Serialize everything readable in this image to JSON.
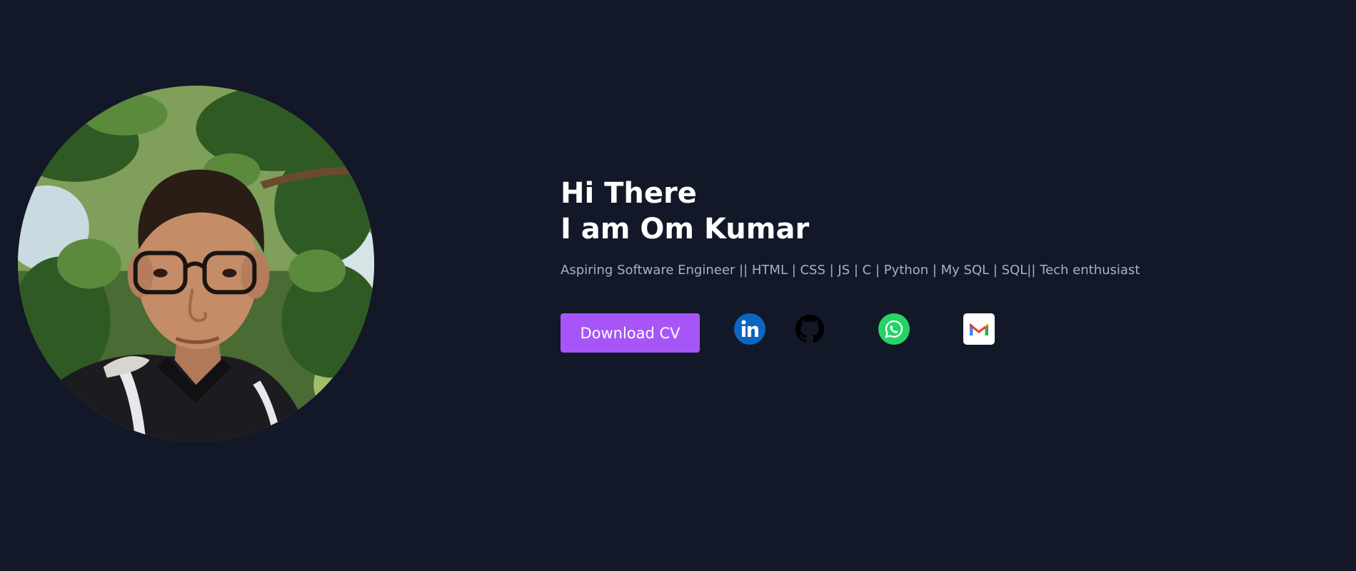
{
  "hero": {
    "greeting_line1": "Hi There",
    "greeting_line2": "I am Om Kumar",
    "tagline": "Aspiring Software Engineer || HTML | CSS | JS | C | Python | My SQL | SQL|| Tech enthusiast",
    "download_label": "Download CV"
  },
  "social": [
    {
      "icon": "linkedin-icon",
      "color": "#0a66c2"
    },
    {
      "icon": "github-icon",
      "color": "#000000"
    },
    {
      "icon": "whatsapp-icon",
      "color": "#25d366"
    },
    {
      "icon": "gmail-icon",
      "color": "#ffffff"
    }
  ],
  "colors": {
    "background": "#121828",
    "accent": "#a855f7",
    "text": "#ffffff",
    "muted": "#a9b0c2"
  }
}
